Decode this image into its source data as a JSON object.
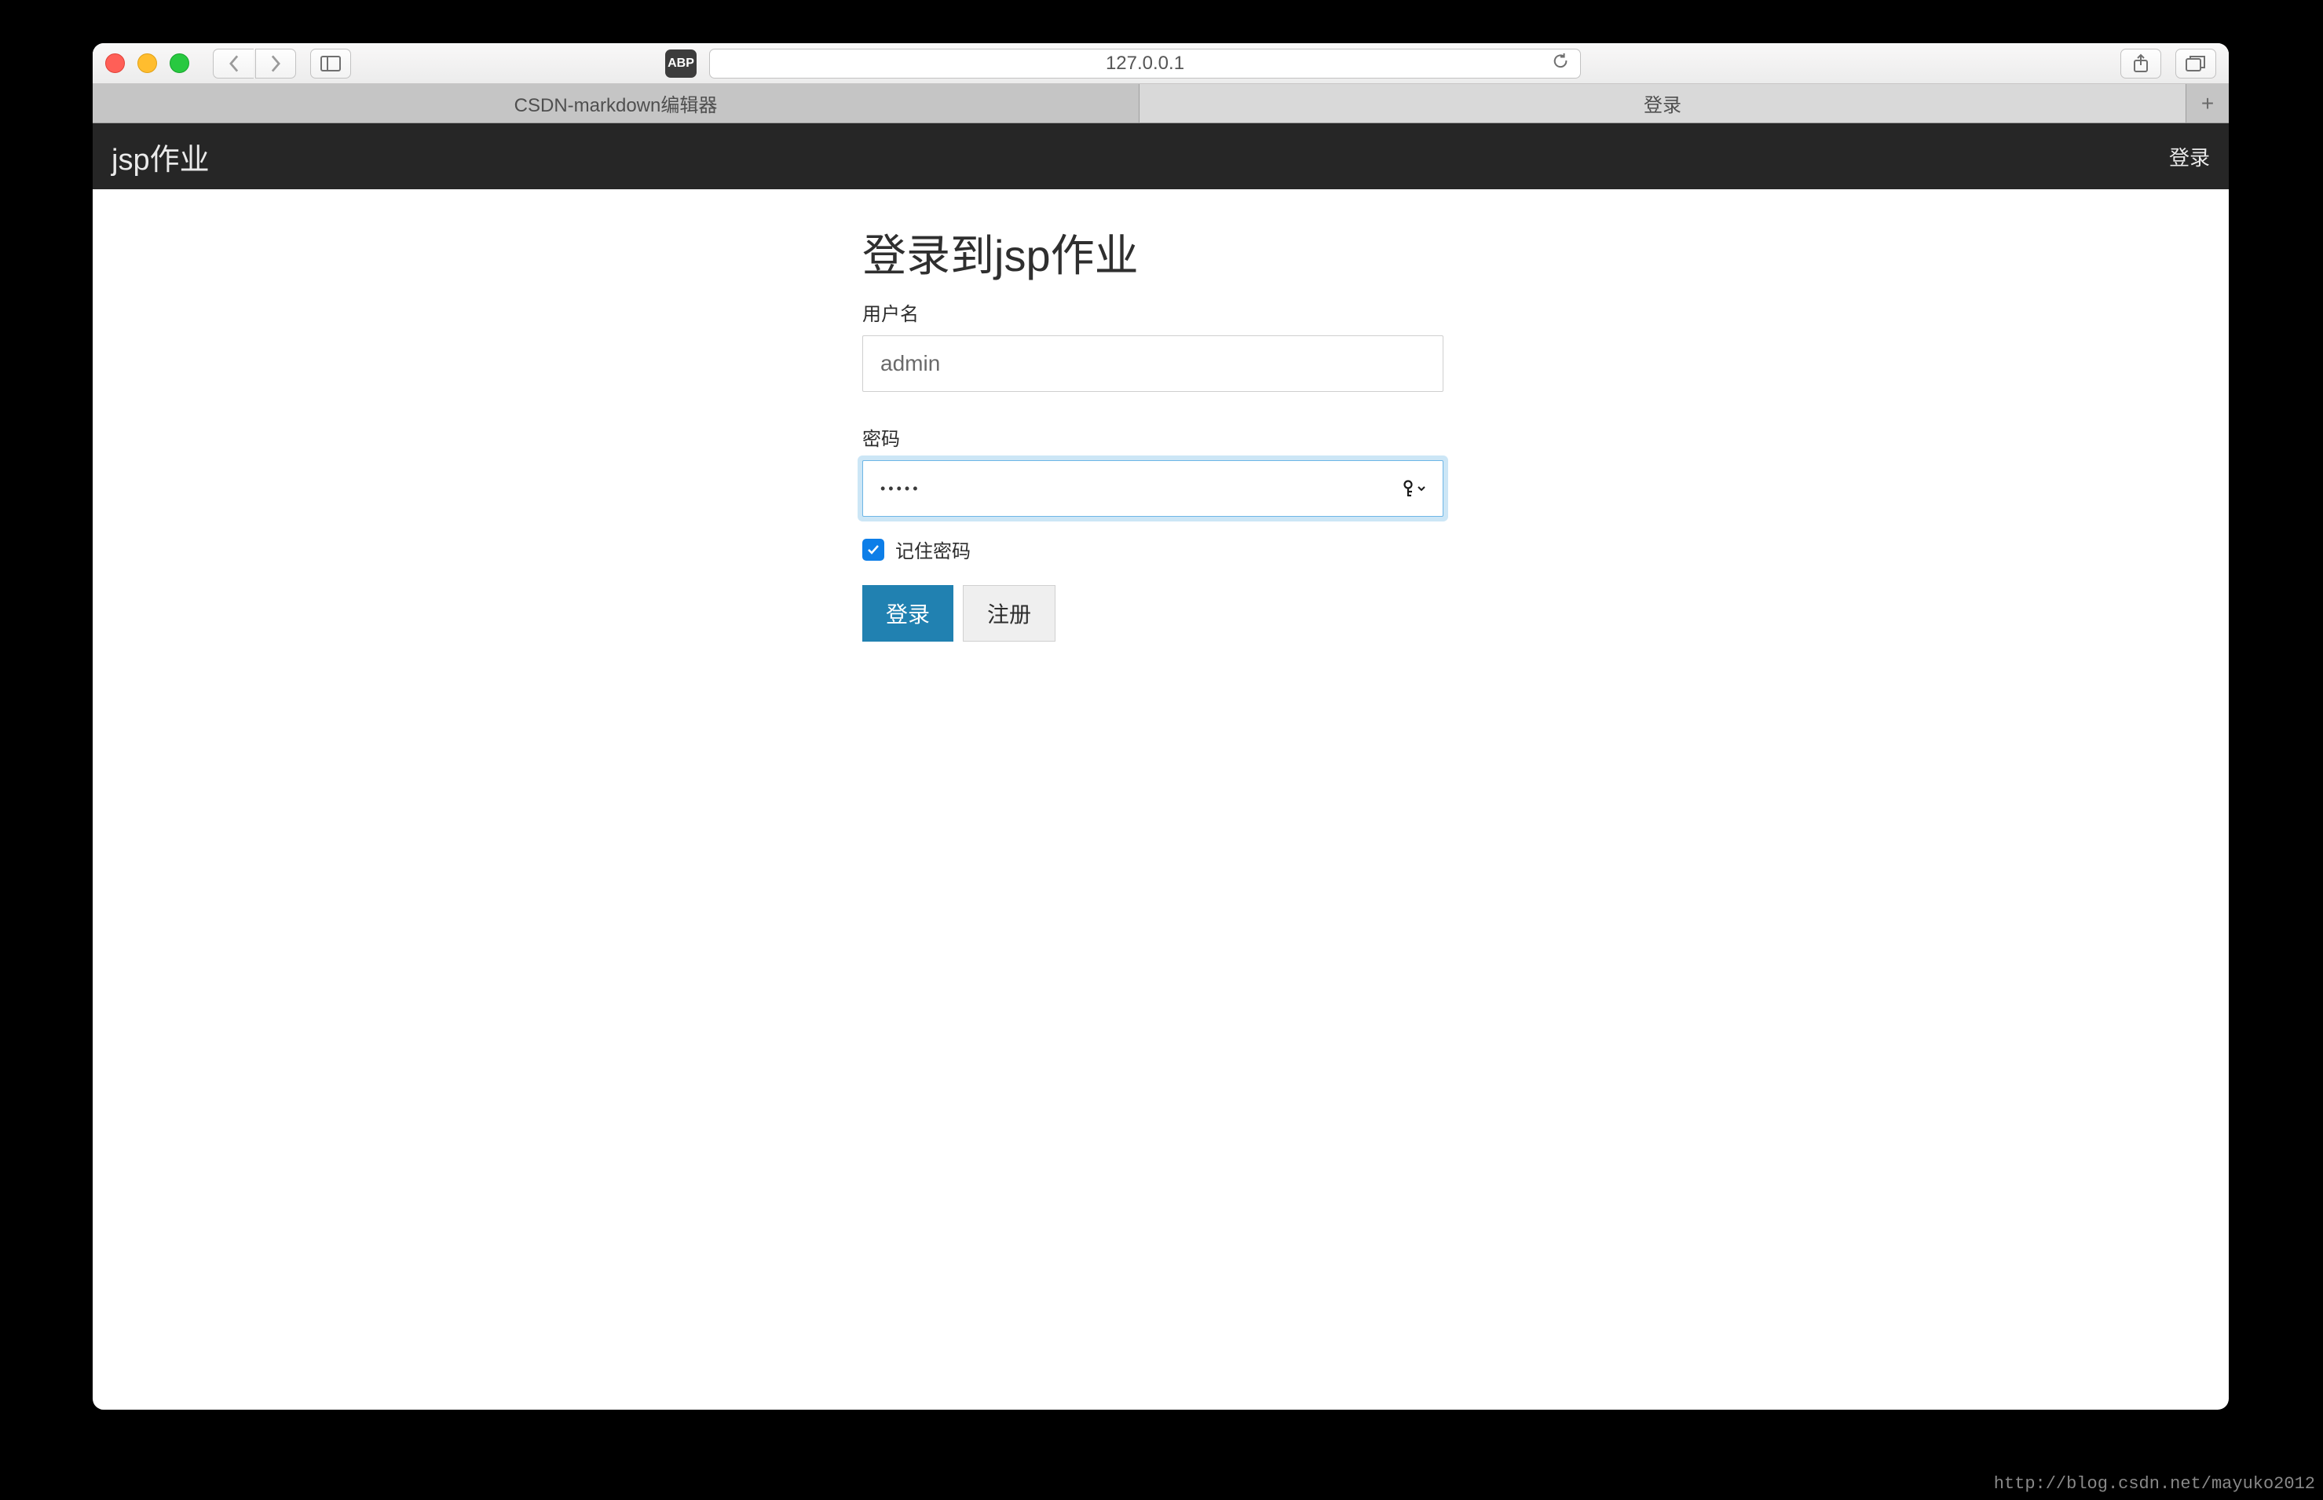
{
  "browser": {
    "address": "127.0.0.1",
    "adblock_label": "ABP",
    "tabs": [
      {
        "label": "CSDN-markdown编辑器",
        "active": false
      },
      {
        "label": "登录",
        "active": true
      }
    ]
  },
  "navbar": {
    "brand": "jsp作业",
    "right_link": "登录"
  },
  "login": {
    "title": "登录到jsp作业",
    "username_label": "用户名",
    "username_value": "admin",
    "password_label": "密码",
    "password_value": "•••••",
    "remember_label": "记住密码",
    "remember_checked": true,
    "submit_label": "登录",
    "register_label": "注册"
  },
  "watermark": "http://blog.csdn.net/mayuko2012"
}
